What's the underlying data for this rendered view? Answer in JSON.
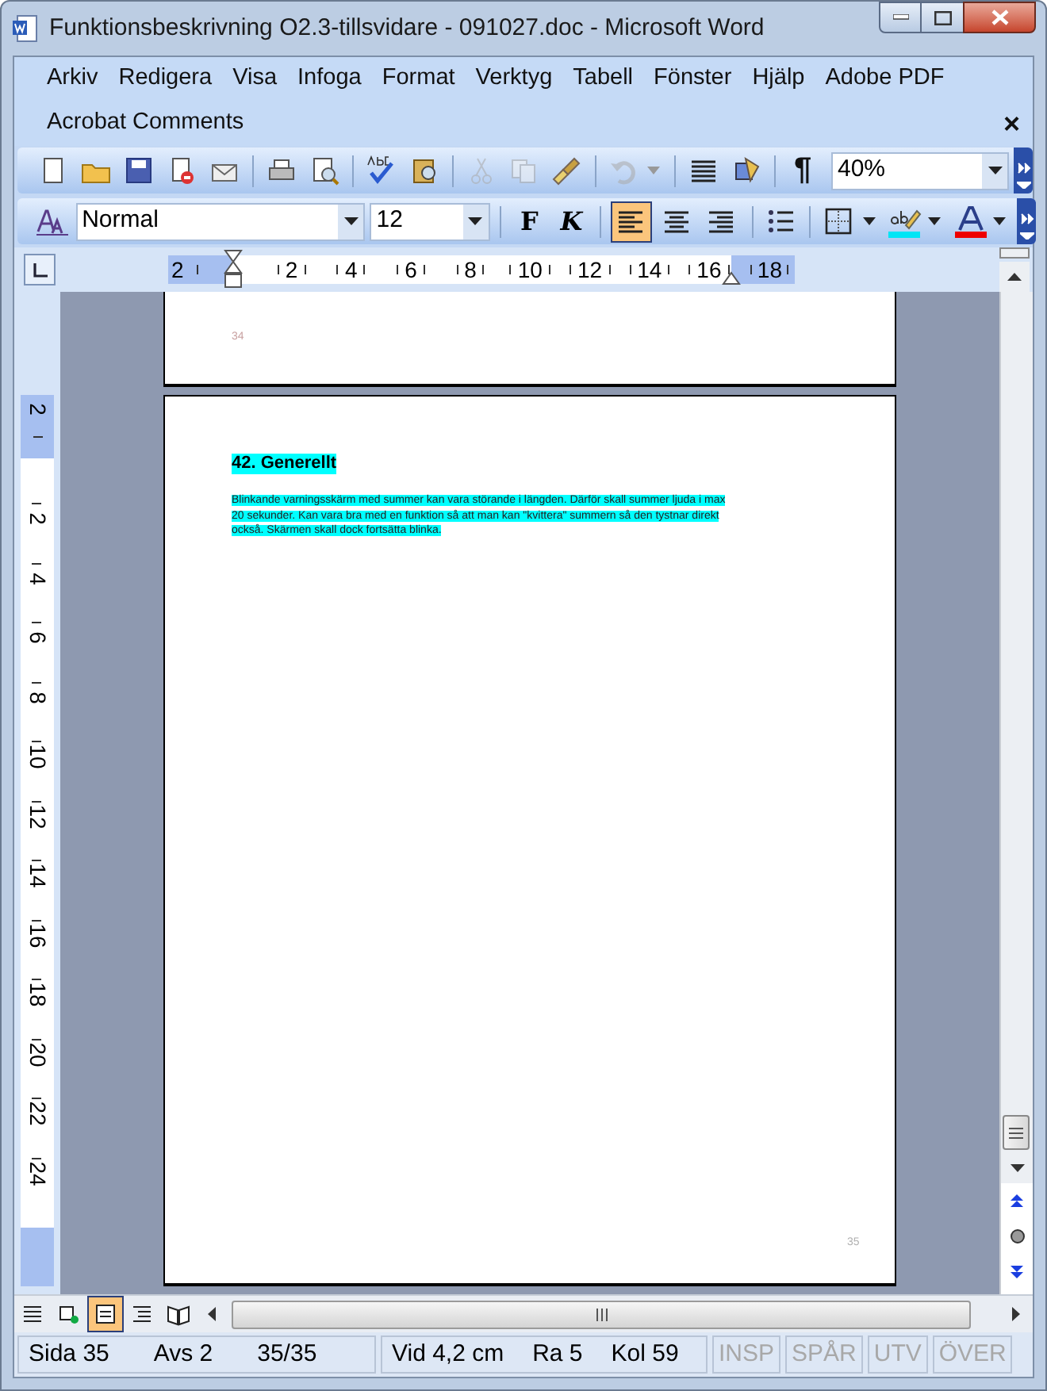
{
  "window": {
    "title": "Funktionsbeskrivning O2.3-tillsvidare - 091027.doc - Microsoft Word"
  },
  "menu": [
    "Arkiv",
    "Redigera",
    "Visa",
    "Infoga",
    "Format",
    "Verktyg",
    "Tabell",
    "Fönster",
    "Hjälp",
    "Adobe PDF",
    "Acrobat Comments"
  ],
  "menu_close": "×",
  "standard_toolbar": {
    "buttons": [
      {
        "kind": "new",
        "disabled": false
      },
      {
        "kind": "open",
        "disabled": false
      },
      {
        "kind": "save",
        "disabled": false
      },
      {
        "kind": "permission",
        "disabled": false
      },
      {
        "kind": "email",
        "disabled": false
      },
      {
        "kind": "print",
        "disabled": false
      },
      {
        "kind": "preview",
        "disabled": false
      },
      {
        "kind": "spelling",
        "disabled": false
      },
      {
        "kind": "research",
        "disabled": false
      },
      {
        "kind": "cut",
        "disabled": true
      },
      {
        "kind": "copy",
        "disabled": true
      },
      {
        "kind": "painter",
        "disabled": false
      },
      {
        "kind": "undo",
        "disabled": true
      },
      {
        "kind": "columns",
        "disabled": false
      },
      {
        "kind": "drawing",
        "disabled": false
      }
    ],
    "show_formatting": "¶",
    "zoom": "40%"
  },
  "formatting_toolbar": {
    "style": "Normal",
    "size": "12",
    "bold": "F",
    "italic": "K",
    "alignment": [
      {
        "kind": "left",
        "selected": true
      },
      {
        "kind": "center",
        "selected": false
      },
      {
        "kind": "right",
        "selected": false
      }
    ]
  },
  "ruler": {
    "labels": [
      "2",
      "2",
      "4",
      "6",
      "8",
      "10",
      "12",
      "14",
      "16",
      "18"
    ]
  },
  "vertical_ruler": {
    "labels": [
      "2",
      "2",
      "4",
      "6",
      "8",
      "10",
      "12",
      "14",
      "16",
      "18",
      "20",
      "22",
      "24"
    ]
  },
  "document": {
    "previous_page_number": "34",
    "heading": "42. Generellt",
    "paragraph": "Blinkande varningsskärm med summer kan vara störande i längden. Därför skall summer ljuda i max 20 sekunder. Kan vara bra med en funktion så att man kan \"kvittera\" summern så den tystnar direkt också. Skärmen skall dock fortsätta blinka.",
    "page_number": "35"
  },
  "view_buttons": [
    {
      "kind": "normal",
      "selected": false
    },
    {
      "kind": "web",
      "selected": false
    },
    {
      "kind": "print",
      "selected": true
    },
    {
      "kind": "outline",
      "selected": false
    },
    {
      "kind": "reading",
      "selected": false
    }
  ],
  "status_bar": {
    "fields": [
      "Sida 35",
      "Avs 2",
      "35/35",
      "Vid 4,2 cm",
      "Ra 5",
      "Kol 59"
    ],
    "modes": [
      {
        "label": "INSP",
        "on": false
      },
      {
        "label": "SPÅR",
        "on": false
      },
      {
        "label": "UTV",
        "on": false
      },
      {
        "label": "ÖVER",
        "on": false
      }
    ]
  }
}
